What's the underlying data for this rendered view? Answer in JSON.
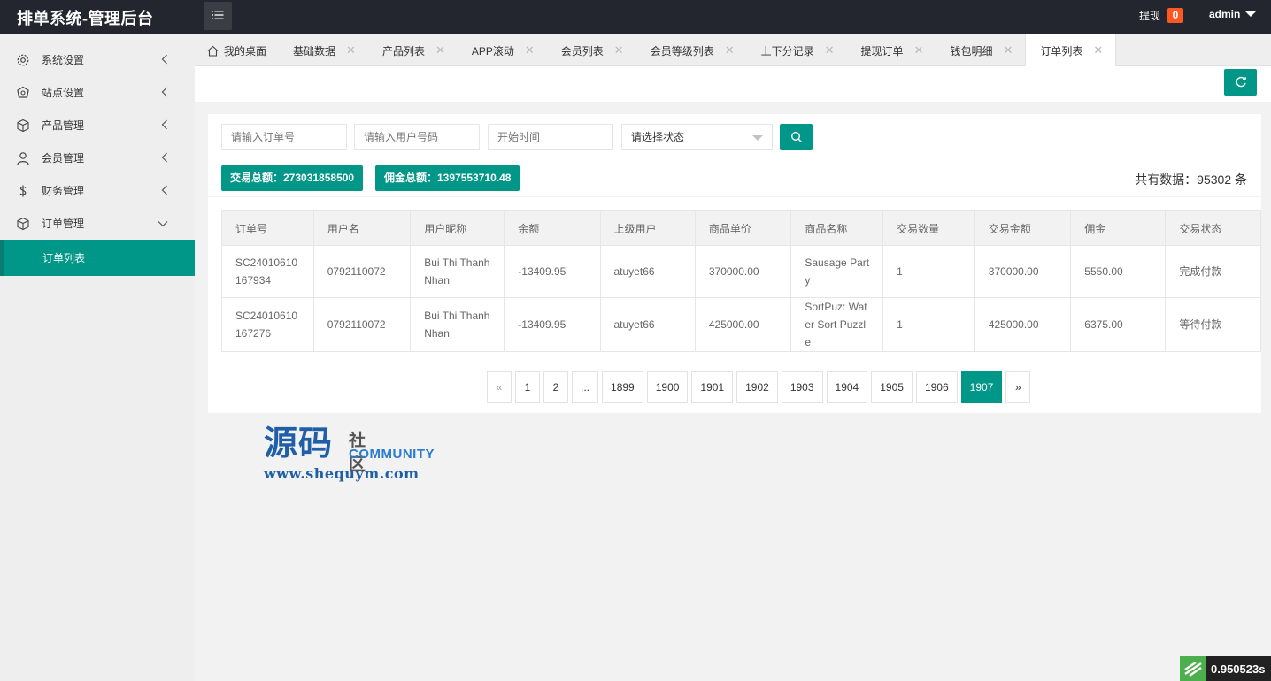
{
  "app": {
    "title": "排单系统-管理后台"
  },
  "header": {
    "withdraw_label": "提现",
    "withdraw_count": "0",
    "user": "admin"
  },
  "sidebar": {
    "items": [
      {
        "label": "系统设置",
        "icon": "gear-icon"
      },
      {
        "label": "站点设置",
        "icon": "site-icon"
      },
      {
        "label": "产品管理",
        "icon": "box-icon"
      },
      {
        "label": "会员管理",
        "icon": "user-icon"
      },
      {
        "label": "财务管理",
        "icon": "dollar-icon"
      },
      {
        "label": "订单管理",
        "icon": "order-icon"
      }
    ],
    "sub_active": "订单列表"
  },
  "tabs": [
    {
      "label": "我的桌面"
    },
    {
      "label": "基础数据"
    },
    {
      "label": "产品列表"
    },
    {
      "label": "APP滚动"
    },
    {
      "label": "会员列表"
    },
    {
      "label": "会员等级列表"
    },
    {
      "label": "上下分记录"
    },
    {
      "label": "提现订单"
    },
    {
      "label": "钱包明细"
    },
    {
      "label": "订单列表"
    }
  ],
  "filters": {
    "order_no_placeholder": "请输入订单号",
    "user_no_placeholder": "请输入用户号码",
    "start_time_placeholder": "开始时间",
    "status_select": "请选择状态"
  },
  "stats": {
    "trade_total": "交易总额：273031858500",
    "commission_total": "佣金总额：1397553710.48",
    "total_records": "共有数据：95302 条"
  },
  "table": {
    "columns": [
      "订单号",
      "用户名",
      "用户昵称",
      "余额",
      "上级用户",
      "商品单价",
      "商品名称",
      "交易数量",
      "交易金额",
      "佣金",
      "交易状态"
    ],
    "rows": [
      [
        "SC24010610167934",
        "0792110072",
        "Bui Thi Thanh Nhan",
        "-13409.95",
        "atuyet66",
        "370000.00",
        "Sausage Party",
        "1",
        "370000.00",
        "5550.00",
        "完成付款"
      ],
      [
        "SC24010610167276",
        "0792110072",
        "Bui Thi Thanh Nhan",
        "-13409.95",
        "atuyet66",
        "425000.00",
        "SortPuz: Water Sort Puzzle",
        "1",
        "425000.00",
        "6375.00",
        "等待付款"
      ]
    ]
  },
  "pagination": {
    "prev": "«",
    "pages": [
      "1",
      "2",
      "...",
      "1899",
      "1900",
      "1901",
      "1902",
      "1903",
      "1904",
      "1905",
      "1906",
      "1907"
    ],
    "current": "1907",
    "next": "»"
  },
  "watermark": {
    "big": "源码",
    "small_cn": "社区",
    "small_en": "COMMUNITY",
    "url": "www.shequym.com"
  },
  "timer": {
    "value": "0.950523s"
  },
  "colors": {
    "accent": "#009688",
    "header": "#23262e",
    "badge": "#ff5722"
  }
}
